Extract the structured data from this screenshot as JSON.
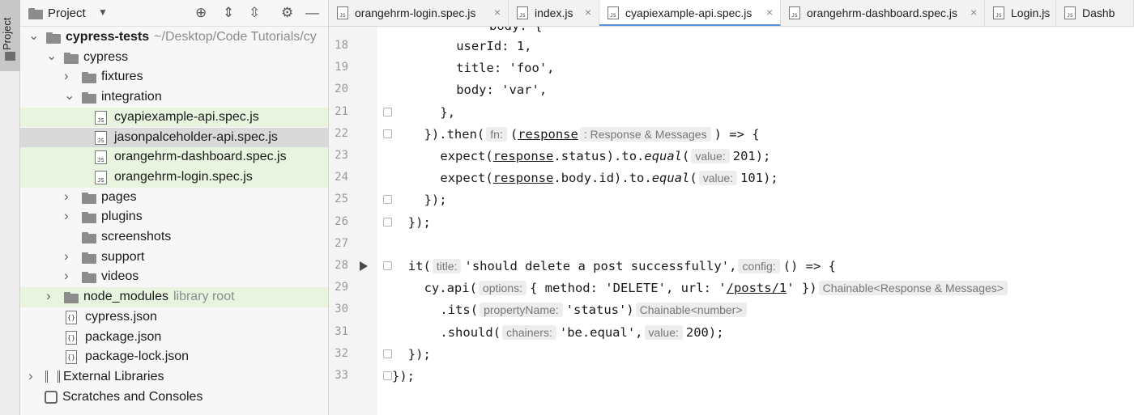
{
  "sidebar_strip": {
    "label": "Project"
  },
  "project_panel": {
    "title": "Project",
    "tree": [
      {
        "label": "cypress-tests",
        "extra": "~/Desktop/Code Tutorials/cy",
        "type": "folder",
        "depth": 0,
        "expanded": true,
        "bold": true
      },
      {
        "label": "cypress",
        "type": "folder",
        "depth": 1,
        "expanded": true
      },
      {
        "label": "fixtures",
        "type": "folder",
        "depth": 2,
        "expanded": false
      },
      {
        "label": "integration",
        "type": "folder",
        "depth": 2,
        "expanded": true
      },
      {
        "label": "cyapiexample-api.spec.js",
        "type": "js",
        "depth": 3,
        "state": "hl"
      },
      {
        "label": "jasonpalceholder-api.spec.js",
        "type": "js",
        "depth": 3,
        "state": "sel"
      },
      {
        "label": "orangehrm-dashboard.spec.js",
        "type": "js",
        "depth": 3,
        "state": "hl"
      },
      {
        "label": "orangehrm-login.spec.js",
        "type": "js",
        "depth": 3,
        "state": "hl"
      },
      {
        "label": "pages",
        "type": "folder",
        "depth": 2,
        "expanded": false
      },
      {
        "label": "plugins",
        "type": "folder",
        "depth": 2,
        "expanded": false
      },
      {
        "label": "screenshots",
        "type": "folder",
        "depth": 2,
        "leaf": true
      },
      {
        "label": "support",
        "type": "folder",
        "depth": 2,
        "expanded": false
      },
      {
        "label": "videos",
        "type": "folder",
        "depth": 2,
        "expanded": false
      },
      {
        "label": "node_modules",
        "extra": "library root",
        "type": "folder",
        "depth": 1,
        "expanded": false,
        "state": "hl"
      },
      {
        "label": "cypress.json",
        "type": "json",
        "depth": 1
      },
      {
        "label": "package.json",
        "type": "json",
        "depth": 1
      },
      {
        "label": "package-lock.json",
        "type": "json",
        "depth": 1
      },
      {
        "label": "External Libraries",
        "type": "lib",
        "depth": 0,
        "expanded": false
      },
      {
        "label": "Scratches and Consoles",
        "type": "scratch",
        "depth": 0,
        "leaf": true
      }
    ]
  },
  "tabs": [
    {
      "label": "orangehrm-login.spec.js",
      "active": false,
      "closable": true
    },
    {
      "label": "index.js",
      "active": false,
      "closable": true
    },
    {
      "label": "cyapiexample-api.spec.js",
      "active": true,
      "closable": true
    },
    {
      "label": "orangehrm-dashboard.spec.js",
      "active": false,
      "closable": true
    },
    {
      "label": "Login.js",
      "active": false,
      "closable": true
    },
    {
      "label": "Dashb",
      "active": false,
      "closable": false
    }
  ],
  "editor": {
    "partial_top_line": "body: {",
    "lines": [
      {
        "num": "18",
        "indent": 8,
        "parts": [
          {
            "t": "userId: 1,"
          }
        ]
      },
      {
        "num": "19",
        "indent": 8,
        "parts": [
          {
            "t": "title: 'foo',"
          }
        ]
      },
      {
        "num": "20",
        "indent": 8,
        "parts": [
          {
            "t": "body: 'var',"
          }
        ]
      },
      {
        "num": "21",
        "indent": 6,
        "fold": true,
        "parts": [
          {
            "t": "},"
          }
        ]
      },
      {
        "num": "22",
        "indent": 4,
        "fold": true,
        "parts": [
          {
            "t": "})."
          },
          {
            "t": "then("
          },
          {
            "hint": "fn:"
          },
          {
            "t": "("
          },
          {
            "t": "response",
            "u": true
          },
          {
            "hint": ": Response & Messages"
          },
          {
            "t": ") => {"
          }
        ]
      },
      {
        "num": "23",
        "indent": 6,
        "parts": [
          {
            "t": "expect("
          },
          {
            "t": "response",
            "u": true
          },
          {
            "t": ".status).to."
          },
          {
            "t": "equal",
            "it": true
          },
          {
            "t": "("
          },
          {
            "hint": "value:"
          },
          {
            "t": "201);"
          }
        ]
      },
      {
        "num": "24",
        "indent": 6,
        "parts": [
          {
            "t": "expect("
          },
          {
            "t": "response",
            "u": true
          },
          {
            "t": ".body.id).to."
          },
          {
            "t": "equal",
            "it": true
          },
          {
            "t": "("
          },
          {
            "hint": "value:"
          },
          {
            "t": "101);"
          }
        ]
      },
      {
        "num": "25",
        "indent": 4,
        "fold": true,
        "parts": [
          {
            "t": "});"
          }
        ]
      },
      {
        "num": "26",
        "indent": 2,
        "fold": true,
        "parts": [
          {
            "t": "});"
          }
        ]
      },
      {
        "num": "27",
        "indent": 0,
        "parts": [
          {
            "t": ""
          }
        ]
      },
      {
        "num": "28",
        "indent": 2,
        "run": true,
        "fold": true,
        "parts": [
          {
            "t": "it("
          },
          {
            "hint": "title:"
          },
          {
            "t": "'should delete a post successfully',"
          },
          {
            "hint": "config:"
          },
          {
            "t": "() => {"
          }
        ]
      },
      {
        "num": "29",
        "indent": 4,
        "parts": [
          {
            "t": "cy.api("
          },
          {
            "hint": "options:"
          },
          {
            "t": "{ method: 'DELETE', url: '"
          },
          {
            "t": "/posts/1",
            "u": true
          },
          {
            "t": "' })"
          },
          {
            "hint": "Chainable<Response & Messages>"
          }
        ]
      },
      {
        "num": "30",
        "indent": 6,
        "parts": [
          {
            "t": ".its("
          },
          {
            "hint": "propertyName:"
          },
          {
            "t": "'status')"
          },
          {
            "hint": "Chainable<number>"
          }
        ]
      },
      {
        "num": "31",
        "indent": 6,
        "parts": [
          {
            "t": ".should("
          },
          {
            "hint": "chainers:"
          },
          {
            "t": "'be.equal',"
          },
          {
            "hint": "value:"
          },
          {
            "t": "200);"
          }
        ]
      },
      {
        "num": "32",
        "indent": 2,
        "fold": true,
        "parts": [
          {
            "t": "});"
          }
        ]
      },
      {
        "num": "33",
        "indent": 0,
        "fold": true,
        "parts": [
          {
            "t": "});"
          }
        ]
      }
    ]
  }
}
